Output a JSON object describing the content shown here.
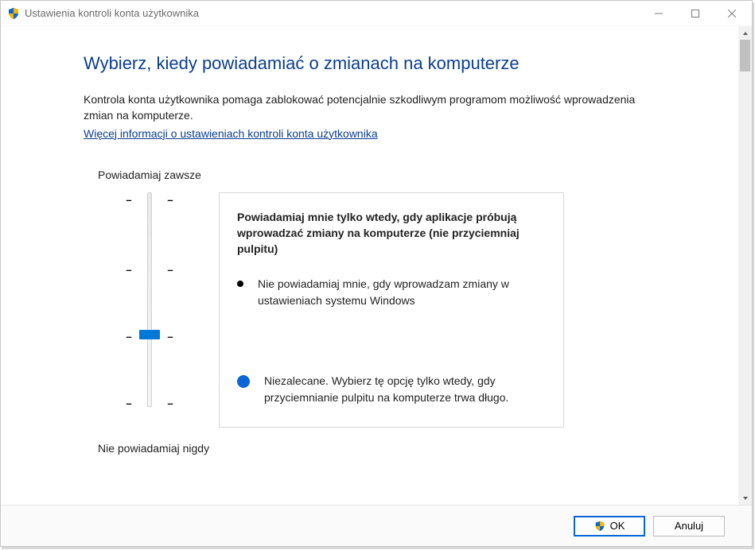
{
  "window": {
    "title": "Ustawienia kontroli konta użytkownika"
  },
  "content": {
    "heading": "Wybierz, kiedy powiadamiać o zmianach na komputerze",
    "lead": "Kontrola konta użytkownika pomaga zablokować potencjalnie szkodliwym programom możliwość wprowadzenia zmian na komputerze.",
    "link": "Więcej informacji o ustawieniach kontroli konta użytkownika",
    "label_top": "Powiadamiaj zawsze",
    "label_bottom": "Nie powiadamiaj nigdy"
  },
  "slider": {
    "levels": 4,
    "current_level": 1
  },
  "description": {
    "title": "Powiadamiaj mnie tylko wtedy, gdy aplikacje próbują wprowadzać zmiany na komputerze (nie przyciemniaj pulpitu)",
    "bullet": "Nie powiadamiaj mnie, gdy wprowadzam zmiany w ustawieniach systemu Windows",
    "recommendation": "Niezalecane. Wybierz tę opcję tylko wtedy, gdy przyciemnianie pulpitu na komputerze trwa długo."
  },
  "footer": {
    "ok_label": "OK",
    "cancel_label": "Anuluj"
  }
}
